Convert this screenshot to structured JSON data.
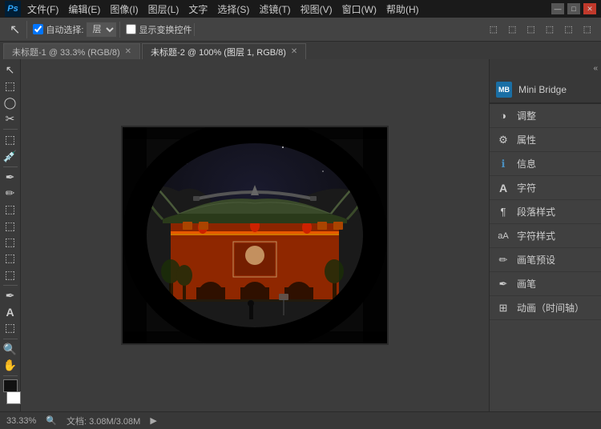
{
  "titlebar": {
    "logo": "Ps",
    "menus": [
      "文件(F)",
      "编辑(E)",
      "图像(I)",
      "图层(L)",
      "文字",
      "选择(S)",
      "滤镜(T)",
      "视图(V)",
      "窗口(W)",
      "帮助(H)"
    ],
    "controls": [
      "—",
      "□",
      "✕"
    ]
  },
  "toolbar": {
    "move_tool": "↖",
    "auto_select_label": "自动选择:",
    "auto_select_value": "层",
    "show_transform": "显示变换控件"
  },
  "tabs": [
    {
      "label": "未标题-1 @ 33.3% (RGB/8)",
      "active": false,
      "modified": true
    },
    {
      "label": "未标题-2 @ 100% (图层 1, RGB/8)",
      "active": true,
      "modified": true
    }
  ],
  "left_tools": [
    "↖",
    "⬚",
    "⬚",
    "◯",
    "✂",
    "⬚",
    "⬚",
    "✒",
    "✒",
    "⬚",
    "⬚",
    "⬚",
    "⬚",
    "⬚",
    "A",
    "⬚",
    "⬚",
    "⬚",
    "⬚",
    "🔍",
    "⬚"
  ],
  "right_panel": {
    "mini_bridge": {
      "icon_text": "MB",
      "label": "Mini Bridge"
    },
    "items": [
      {
        "icon": "🔍",
        "label": "调整"
      },
      {
        "icon": "🔧",
        "label": "属性"
      },
      {
        "icon": "ℹ",
        "label": "信息"
      },
      {
        "icon": "A",
        "label": "字符"
      },
      {
        "icon": "¶",
        "label": "段落样式"
      },
      {
        "icon": "T",
        "label": "字符样式"
      },
      {
        "icon": "✏",
        "label": "画笔预设"
      },
      {
        "icon": "✏",
        "label": "画笔"
      },
      {
        "icon": "⏱",
        "label": "动画（时间轴）"
      }
    ]
  },
  "statusbar": {
    "zoom": "33.33%",
    "info": "文档: 3.08M/3.08M"
  }
}
